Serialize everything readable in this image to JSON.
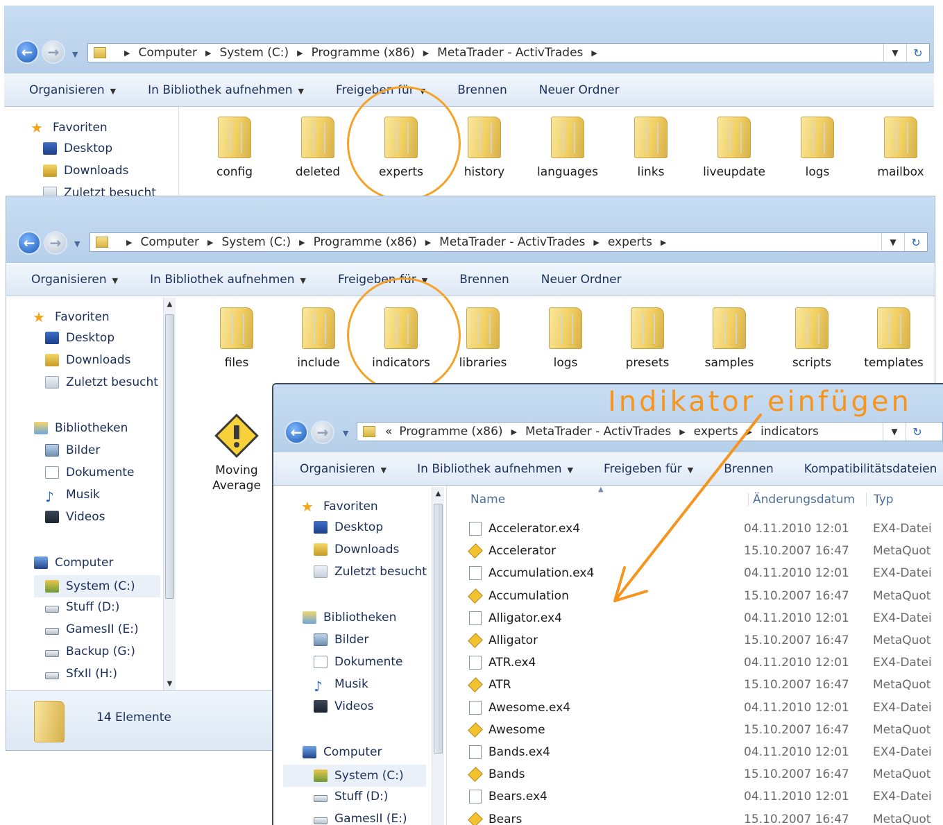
{
  "colors": {
    "accent_circle": "#f6a229",
    "arrow": "#f7941d",
    "annotation": "#f7941d"
  },
  "window1": {
    "breadcrumb": [
      "Computer",
      "System (C:)",
      "Programme (x86)",
      "MetaTrader - ActivTrades"
    ],
    "toolbar": [
      "Organisieren",
      "In Bibliothek aufnehmen",
      "Freigeben für",
      "Brennen",
      "Neuer Ordner"
    ],
    "nav": [
      "Favoriten",
      "Desktop",
      "Downloads",
      "Zuletzt besucht"
    ],
    "folders": [
      "config",
      "deleted",
      "experts",
      "history",
      "languages",
      "links",
      "liveupdate",
      "logs",
      "mailbox"
    ]
  },
  "window2": {
    "breadcrumb": [
      "Computer",
      "System (C:)",
      "Programme (x86)",
      "MetaTrader - ActivTrades",
      "experts"
    ],
    "toolbar": [
      "Organisieren",
      "In Bibliothek aufnehmen",
      "Freigeben für",
      "Brennen",
      "Neuer Ordner"
    ],
    "nav": {
      "favorites": [
        "Favoriten",
        "Desktop",
        "Downloads",
        "Zuletzt besucht"
      ],
      "libraries": [
        "Bibliotheken",
        "Bilder",
        "Dokumente",
        "Musik",
        "Videos"
      ],
      "computer": [
        "Computer",
        "System (C:)",
        "Stuff (D:)",
        "GamesII (E:)",
        "Backup (G:)",
        "SfxII (H:)"
      ]
    },
    "folders": [
      "files",
      "include",
      "indicators",
      "libraries",
      "logs",
      "presets",
      "samples",
      "scripts",
      "templates"
    ],
    "file_item": "Moving Average",
    "status": "14 Elemente"
  },
  "window3": {
    "annotation": "Indikator einfügen",
    "breadcrumb_prefix": "«",
    "breadcrumb": [
      "Programme (x86)",
      "MetaTrader - ActivTrades",
      "experts",
      "indicators"
    ],
    "toolbar": [
      "Organisieren",
      "In Bibliothek aufnehmen",
      "Freigeben für",
      "Brennen",
      "Kompatibilitätsdateien"
    ],
    "nav": {
      "favorites": [
        "Favoriten",
        "Desktop",
        "Downloads",
        "Zuletzt besucht"
      ],
      "libraries": [
        "Bibliotheken",
        "Bilder",
        "Dokumente",
        "Musik",
        "Videos"
      ],
      "computer": [
        "Computer",
        "System (C:)",
        "Stuff (D:)",
        "GamesII (E:)"
      ]
    },
    "columns": {
      "name": "Name",
      "date": "Änderungsdatum",
      "type": "Typ"
    },
    "files": [
      {
        "name": "Accelerator.ex4",
        "date": "04.11.2010 12:01",
        "type": "EX4-Datei",
        "icon": "ex4-file-icon"
      },
      {
        "name": "Accelerator",
        "date": "15.10.2007 16:47",
        "type": "MetaQuot",
        "icon": "mq4-file-icon"
      },
      {
        "name": "Accumulation.ex4",
        "date": "04.11.2010 12:01",
        "type": "EX4-Datei",
        "icon": "ex4-file-icon"
      },
      {
        "name": "Accumulation",
        "date": "15.10.2007 16:47",
        "type": "MetaQuot",
        "icon": "mq4-file-icon"
      },
      {
        "name": "Alligator.ex4",
        "date": "04.11.2010 12:01",
        "type": "EX4-Datei",
        "icon": "ex4-file-icon"
      },
      {
        "name": "Alligator",
        "date": "15.10.2007 16:47",
        "type": "MetaQuot",
        "icon": "mq4-file-icon"
      },
      {
        "name": "ATR.ex4",
        "date": "04.11.2010 12:01",
        "type": "EX4-Datei",
        "icon": "ex4-file-icon"
      },
      {
        "name": "ATR",
        "date": "15.10.2007 16:47",
        "type": "MetaQuot",
        "icon": "mq4-file-icon"
      },
      {
        "name": "Awesome.ex4",
        "date": "04.11.2010 12:01",
        "type": "EX4-Datei",
        "icon": "ex4-file-icon"
      },
      {
        "name": "Awesome",
        "date": "15.10.2007 16:47",
        "type": "MetaQuot",
        "icon": "mq4-file-icon"
      },
      {
        "name": "Bands.ex4",
        "date": "04.11.2010 12:01",
        "type": "EX4-Datei",
        "icon": "ex4-file-icon"
      },
      {
        "name": "Bands",
        "date": "15.10.2007 16:47",
        "type": "MetaQuot",
        "icon": "mq4-file-icon"
      },
      {
        "name": "Bears.ex4",
        "date": "04.11.2010 12:01",
        "type": "EX4-Datei",
        "icon": "ex4-file-icon"
      },
      {
        "name": "Bears",
        "date": "15.10.2007 16:47",
        "type": "MetaQuot",
        "icon": "mq4-file-icon"
      }
    ]
  }
}
